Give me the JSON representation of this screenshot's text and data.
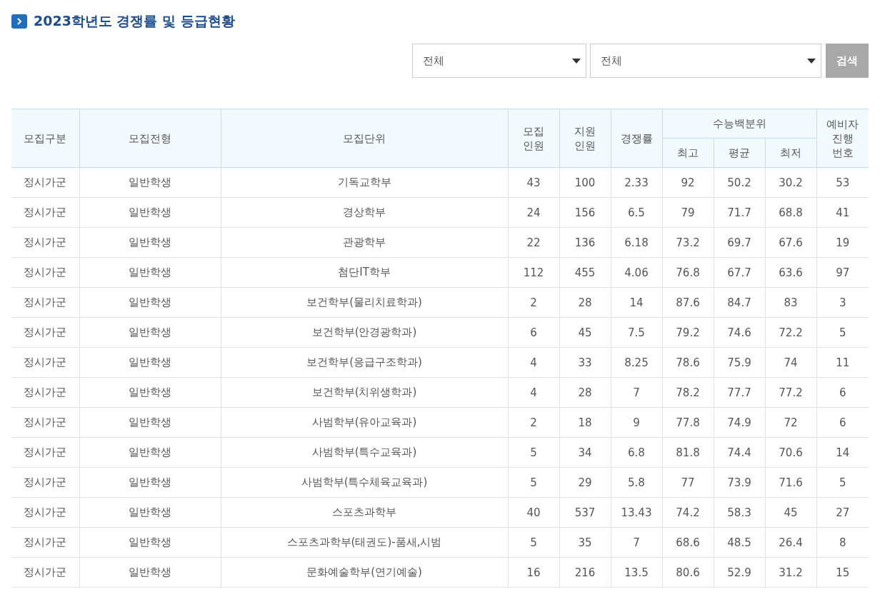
{
  "title": "2023학년도 경쟁률 및 등급현황",
  "filters": [
    {
      "value": "전체"
    },
    {
      "value": "전체"
    }
  ],
  "search_button": "검색",
  "table": {
    "columns": [
      "모집구분",
      "모집전형",
      "모집단위",
      "모집\n인원",
      "지원\n인원",
      "경쟁률"
    ],
    "group": {
      "label": "수능백분위",
      "columns": [
        "최고",
        "평균",
        "최저"
      ]
    },
    "last_column": "예비자\n진행\n번호",
    "rows": [
      [
        "정시가군",
        "일반학생",
        "기독교학부",
        "43",
        "100",
        "2.33",
        "92",
        "50.2",
        "30.2",
        "53"
      ],
      [
        "정시가군",
        "일반학생",
        "경상학부",
        "24",
        "156",
        "6.5",
        "79",
        "71.7",
        "68.8",
        "41"
      ],
      [
        "정시가군",
        "일반학생",
        "관광학부",
        "22",
        "136",
        "6.18",
        "73.2",
        "69.7",
        "67.6",
        "19"
      ],
      [
        "정시가군",
        "일반학생",
        "첨단IT학부",
        "112",
        "455",
        "4.06",
        "76.8",
        "67.7",
        "63.6",
        "97"
      ],
      [
        "정시가군",
        "일반학생",
        "보건학부(물리치료학과)",
        "2",
        "28",
        "14",
        "87.6",
        "84.7",
        "83",
        "3"
      ],
      [
        "정시가군",
        "일반학생",
        "보건학부(안경광학과)",
        "6",
        "45",
        "7.5",
        "79.2",
        "74.6",
        "72.2",
        "5"
      ],
      [
        "정시가군",
        "일반학생",
        "보건학부(응급구조학과)",
        "4",
        "33",
        "8.25",
        "78.6",
        "75.9",
        "74",
        "11"
      ],
      [
        "정시가군",
        "일반학생",
        "보건학부(치위생학과)",
        "4",
        "28",
        "7",
        "78.2",
        "77.7",
        "77.2",
        "6"
      ],
      [
        "정시가군",
        "일반학생",
        "사범학부(유아교육과)",
        "2",
        "18",
        "9",
        "77.8",
        "74.9",
        "72",
        "6"
      ],
      [
        "정시가군",
        "일반학생",
        "사범학부(특수교육과)",
        "5",
        "34",
        "6.8",
        "81.8",
        "74.4",
        "70.6",
        "14"
      ],
      [
        "정시가군",
        "일반학생",
        "사범학부(특수체육교육과)",
        "5",
        "29",
        "5.8",
        "77",
        "73.9",
        "71.6",
        "5"
      ],
      [
        "정시가군",
        "일반학생",
        "스포츠과학부",
        "40",
        "537",
        "13.43",
        "74.2",
        "58.3",
        "45",
        "27"
      ],
      [
        "정시가군",
        "일반학생",
        "스포츠과학부(태권도)-품새,시범",
        "5",
        "35",
        "7",
        "68.6",
        "48.5",
        "26.4",
        "8"
      ],
      [
        "정시가군",
        "일반학생",
        "문화예술학부(연기예술)",
        "16",
        "216",
        "13.5",
        "80.6",
        "52.9",
        "31.2",
        "15"
      ]
    ]
  }
}
